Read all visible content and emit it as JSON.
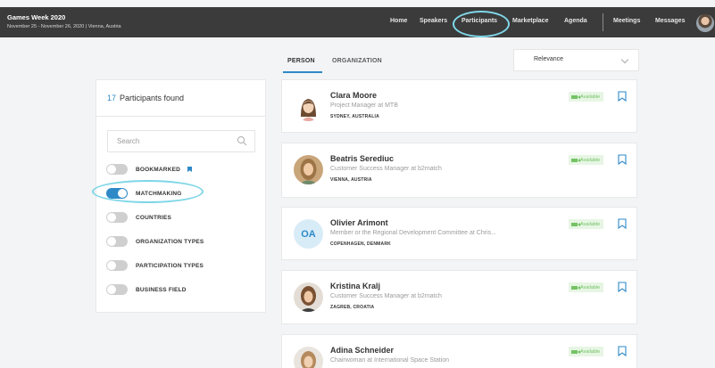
{
  "event": {
    "title": "Games Week 2020",
    "subtitle": "November 25 - November 26, 2020 | Vienna, Austria"
  },
  "nav": {
    "items": [
      "Home",
      "Speakers",
      "Participants",
      "Marketplace",
      "Agenda"
    ],
    "active": "Participants",
    "right_items": [
      "Meetings",
      "Messages"
    ]
  },
  "tabs": {
    "person": "PERSON",
    "organization": "ORGANIZATION",
    "active": "PERSON"
  },
  "sort": {
    "value": "Relevance"
  },
  "filters": {
    "count": "17",
    "count_label": "Participants found",
    "search_placeholder": "Search",
    "items": [
      {
        "label": "BOOKMARKED",
        "on": false,
        "icon": "bookmark-icon"
      },
      {
        "label": "MATCHMAKING",
        "on": true
      },
      {
        "label": "COUNTRIES",
        "on": false
      },
      {
        "label": "ORGANIZATION TYPES",
        "on": false
      },
      {
        "label": "PARTICIPATION TYPES",
        "on": false
      },
      {
        "label": "BUSINESS FIELD",
        "on": false
      }
    ]
  },
  "participants": [
    {
      "name": "Clara Moore",
      "role": "Project Manager at MTB",
      "location": "SYDNEY, AUSTRALIA",
      "status": "Available",
      "avatar": "illustrated-woman"
    },
    {
      "name": "Beatris Serediuc",
      "role": "Customer Success Manager at b2match",
      "location": "VIENNA, AUSTRIA",
      "status": "Available",
      "avatar": "photo"
    },
    {
      "name": "Olivier Arimont",
      "role": "Member or the Regional Development Committee at Chris...",
      "location": "COPENHAGEN, DENMARK",
      "status": "Available",
      "initials": "OA"
    },
    {
      "name": "Kristina Kralj",
      "role": "Customer Success Manager at b2match",
      "location": "ZAGREB, CROATIA",
      "status": "Available",
      "avatar": "photo"
    },
    {
      "name": "Adina Schneider",
      "role": "Chairwoman at International Space Station",
      "location": "",
      "status": "Available",
      "avatar": "photo"
    }
  ],
  "colors": {
    "accent": "#2e89c7",
    "topbar": "#3b3b3b",
    "available": "#74c365",
    "highlight": "#7fd6e8"
  }
}
